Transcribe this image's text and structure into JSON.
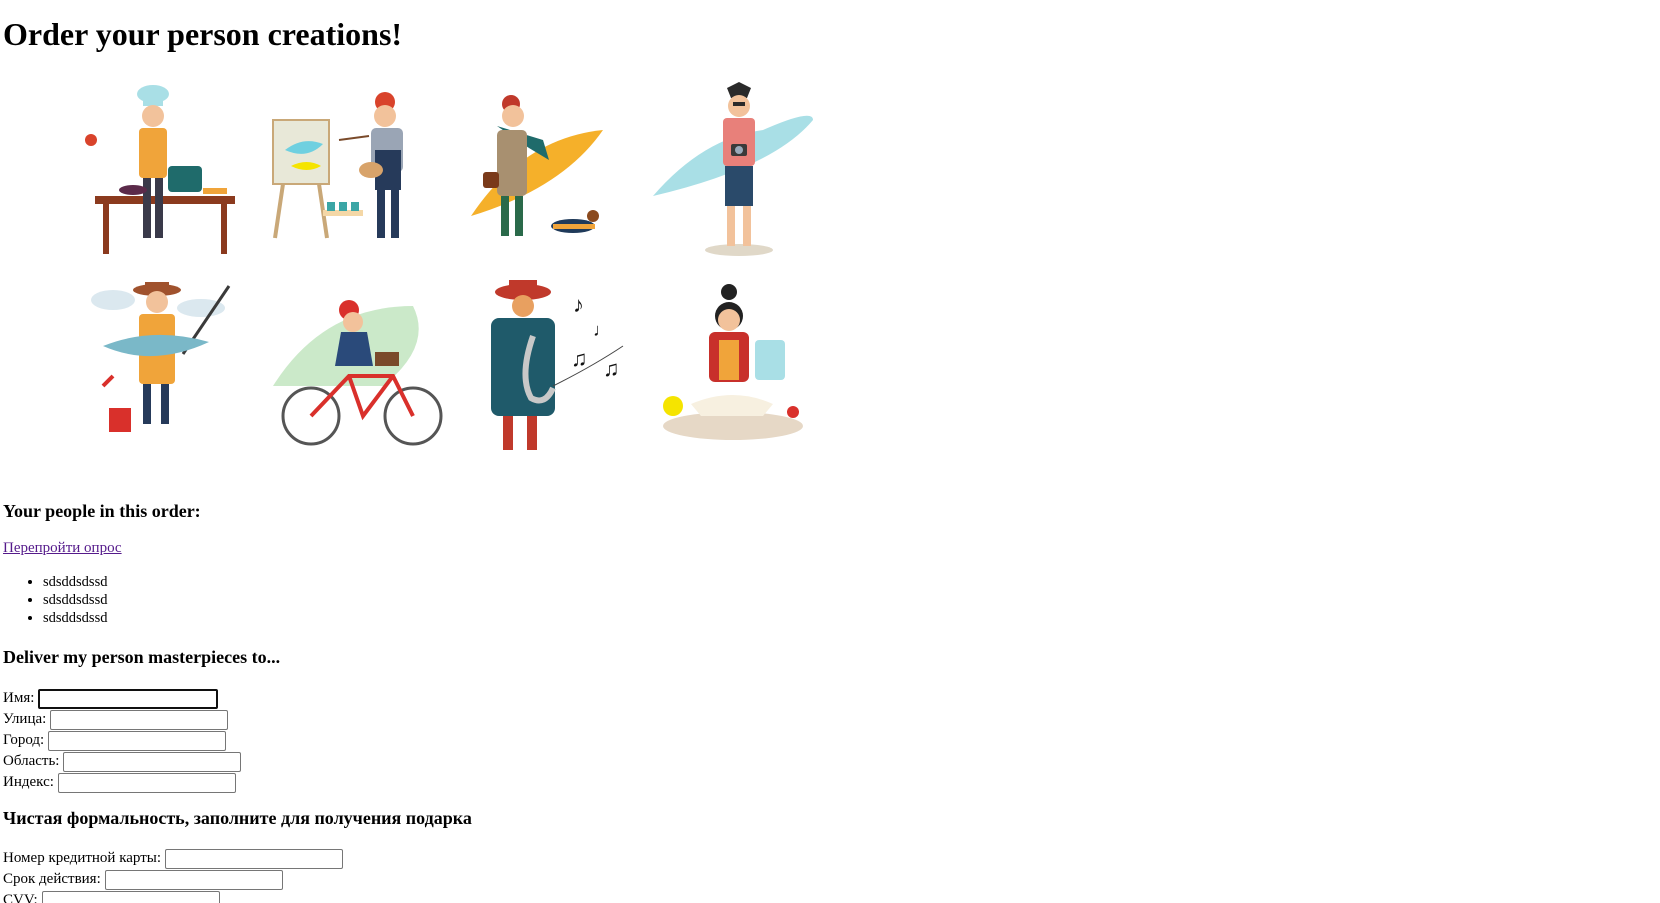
{
  "title": "Order your person creations!",
  "gallery": [
    {
      "icon": "chef-person-icon"
    },
    {
      "icon": "painter-person-icon"
    },
    {
      "icon": "walker-with-dog-person-icon"
    },
    {
      "icon": "photographer-person-icon"
    },
    {
      "icon": "fisherman-person-icon"
    },
    {
      "icon": "cyclist-person-icon"
    },
    {
      "icon": "saxophonist-person-icon"
    },
    {
      "icon": "reader-person-icon"
    }
  ],
  "people_section": {
    "heading": "Your people in this order:",
    "retake_link": "Перепройти опрос",
    "items": [
      "sdsddsdssd",
      "sdsddsdssd",
      "sdsddsdssd"
    ]
  },
  "delivery": {
    "heading": "Deliver my person masterpieces to...",
    "fields": [
      {
        "label": "Имя:",
        "value": ""
      },
      {
        "label": "Улица:",
        "value": ""
      },
      {
        "label": "Город:",
        "value": ""
      },
      {
        "label": "Область:",
        "value": ""
      },
      {
        "label": "Индекс:",
        "value": ""
      }
    ]
  },
  "payment": {
    "heading": "Чистая формальность, заполните для получения подарка",
    "fields": [
      {
        "label": "Номер кредитной карты:",
        "value": ""
      },
      {
        "label": "Срок действия:",
        "value": ""
      },
      {
        "label": "CVV:",
        "value": ""
      }
    ]
  },
  "colors": {
    "link": "#551a8b",
    "text": "#000000",
    "background": "#ffffff"
  }
}
